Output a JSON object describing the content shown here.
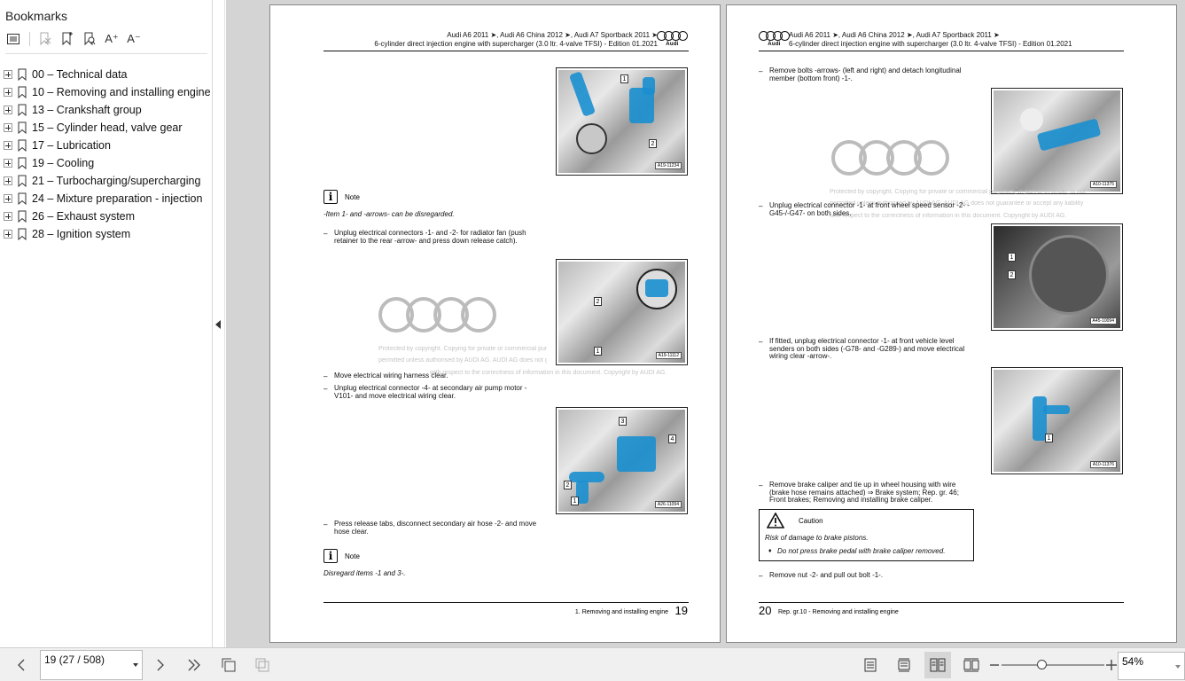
{
  "sidebar": {
    "title": "Bookmarks",
    "toolbar": [
      {
        "icon": "list-options-icon"
      },
      {
        "icon": "bookmark-remove-icon"
      },
      {
        "icon": "bookmark-add-icon"
      },
      {
        "icon": "bookmark-search-icon"
      },
      {
        "icon": "increase-text-size-icon",
        "label": "A⁺"
      },
      {
        "icon": "decrease-text-size-icon",
        "label": "A⁻"
      }
    ],
    "items": [
      {
        "label": "00 – Technical data"
      },
      {
        "label": "10 – Removing and installing engine"
      },
      {
        "label": "13 – Crankshaft group"
      },
      {
        "label": "15 – Cylinder head, valve gear"
      },
      {
        "label": "17 – Lubrication"
      },
      {
        "label": "19 – Cooling"
      },
      {
        "label": "21 – Turbocharging/supercharging"
      },
      {
        "label": "24 – Mixture preparation - injection"
      },
      {
        "label": "26 – Exhaust system"
      },
      {
        "label": "28 – Ignition system"
      }
    ]
  },
  "document": {
    "header_line1": "Audi A6 2011 ➤, Audi A6 China 2012 ➤, Audi A7 Sportback 2011 ➤",
    "header_line2": "6-cylinder direct injection engine with supercharger (3.0 ltr. 4-valve TFSI) - Edition 01.2021",
    "audi_word": "Audi",
    "watermark_line1": "Protected by copyright. Copying for private or commercial purposes, in part or in whole, is not",
    "watermark_line2": "permitted unless authorised by AUDI AG. AUDI AG does not guarantee or accept any liability",
    "watermark_line3": "with respect to the correctness of information in this document. Copyright by AUDI AG.",
    "left_page": {
      "note1_label": "Note",
      "note1_text": "-Item 1- and -arrows- can be disregarded.",
      "step1": "Unplug electrical connectors -1- and -2- for radiator fan (push retainer to the rear -arrow- and press down release catch).",
      "step2": "Move electrical wiring harness clear.",
      "step3": "Unplug electrical connector -4- at secondary air pump motor -V101- and move electrical wiring clear.",
      "step4": "Press release tabs, disconnect secondary air hose -2- and move hose clear.",
      "note2_label": "Note",
      "note2_text": "Disregard items -1 and 3-.",
      "footer": "1. Removing and installing engine",
      "page_number": "19",
      "photo1_code": "A19-11234",
      "photo2_code": "A19-11112",
      "photo3_code": "A26-11094"
    },
    "right_page": {
      "step1": "Remove bolts -arrows- (left and right) and detach longitudinal member (bottom front) -1-.",
      "step2": "Unplug electrical connector -1- at front wheel speed sensor -2- -G45-/-G47- on both sides.",
      "step3": "If fitted, unplug electrical connector -1- at front vehicle level senders on both sides (-G78- and -G289-) and move electrical wiring clear -arrow-.",
      "step4": "Remove brake caliper and tie up in wheel housing with wire (brake hose remains attached) ⇒ Brake system; Rep. gr. 46; Front brakes; Removing and installing brake caliper.",
      "caution_label": "Caution",
      "caution_text": "Risk of damage to brake pistons.",
      "caution_bullet": "Do not press brake pedal with brake caliper removed.",
      "step5": "Remove nut -2- and pull out bolt -1-.",
      "footer": "Rep. gr.10 - Removing and installing engine",
      "page_number": "20",
      "photo1_code": "A10-11375",
      "photo2_code": "A45-10094",
      "photo3_code": "A10-11376"
    }
  },
  "statusbar": {
    "page_field": "19 (27 / 508)",
    "zoom_field": "54%",
    "zoom_level": 0.39
  }
}
